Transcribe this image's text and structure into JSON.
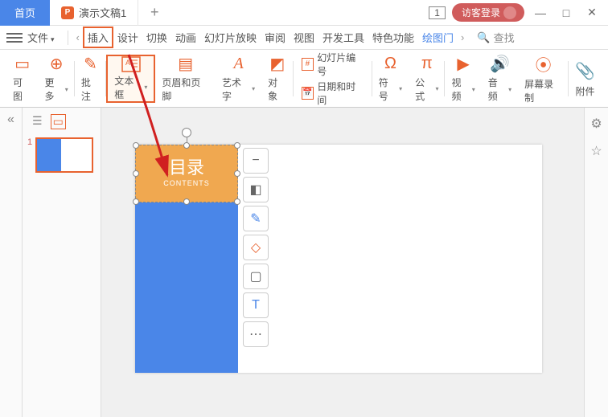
{
  "titlebar": {
    "home_tab": "首页",
    "doc_tab": "演示文稿1",
    "add_tab": "+",
    "badge": "1",
    "login": "访客登录"
  },
  "menubar": {
    "file": "文件",
    "tabs": [
      "插入",
      "设计",
      "切换",
      "动画",
      "幻灯片放映",
      "审阅",
      "视图",
      "开发工具",
      "特色功能",
      "绘图门"
    ],
    "search": "查找"
  },
  "ribbon": {
    "g1": "可图",
    "g2": "更多",
    "g3": "批注",
    "g4": "文本框",
    "g5": "页眉和页脚",
    "g6": "艺术字",
    "g7": "对象",
    "g8a": "幻灯片编号",
    "g8b": "日期和时间",
    "g9": "符号",
    "g10": "公式",
    "g11": "视频",
    "g12": "音频",
    "g13": "屏幕录制",
    "g14": "附件"
  },
  "thumbnails": {
    "slide_num": "1"
  },
  "slide": {
    "title": "目录",
    "subtitle": "CONTENTS"
  },
  "float_icons": [
    "−",
    "◧",
    "✎",
    "◇",
    "▢",
    "T",
    "⋯"
  ]
}
